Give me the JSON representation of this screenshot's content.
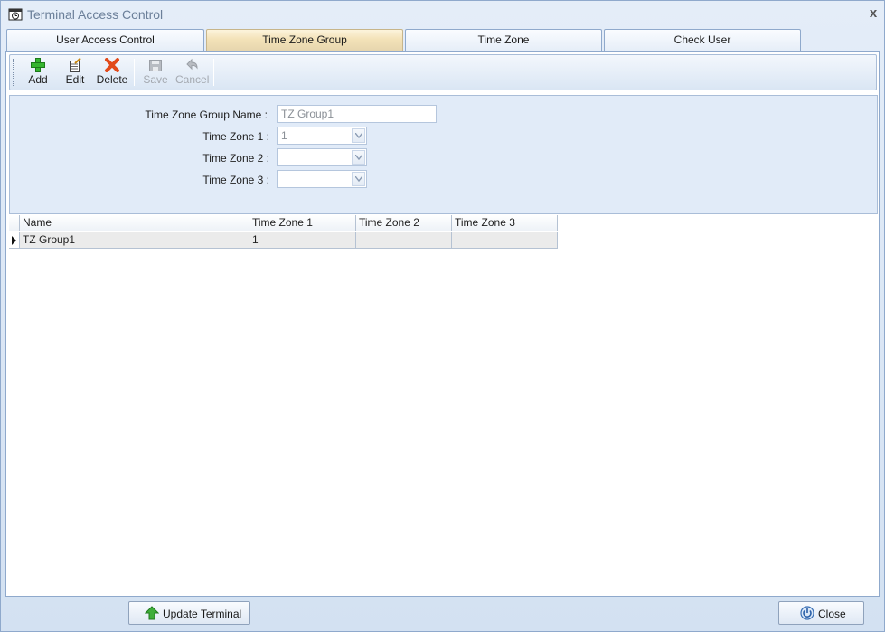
{
  "window": {
    "title": "Terminal Access Control",
    "close_glyph": "x"
  },
  "tabs": [
    {
      "label": "User Access Control",
      "active": false
    },
    {
      "label": "Time Zone Group",
      "active": true
    },
    {
      "label": "Time Zone",
      "active": false
    },
    {
      "label": "Check User",
      "active": false
    }
  ],
  "toolbar": {
    "add": "Add",
    "edit": "Edit",
    "delete": "Delete",
    "save": "Save",
    "cancel": "Cancel"
  },
  "form": {
    "group_name_label": "Time Zone Group Name :",
    "group_name_value": "TZ Group1",
    "tz1_label": "Time Zone 1 :",
    "tz1_value": "1",
    "tz2_label": "Time Zone 2 :",
    "tz2_value": "",
    "tz3_label": "Time Zone 3 :",
    "tz3_value": ""
  },
  "grid": {
    "columns": [
      "Name",
      "Time Zone 1",
      "Time Zone 2",
      "Time Zone 3"
    ],
    "rows": [
      [
        "TZ Group1",
        "1",
        "",
        ""
      ]
    ]
  },
  "footer": {
    "update_terminal": "Update Terminal",
    "close": "Close"
  },
  "colors": {
    "accent_active_tab": "#f3e2b8",
    "add_icon": "#2fa52a",
    "delete_icon": "#e2471b"
  }
}
